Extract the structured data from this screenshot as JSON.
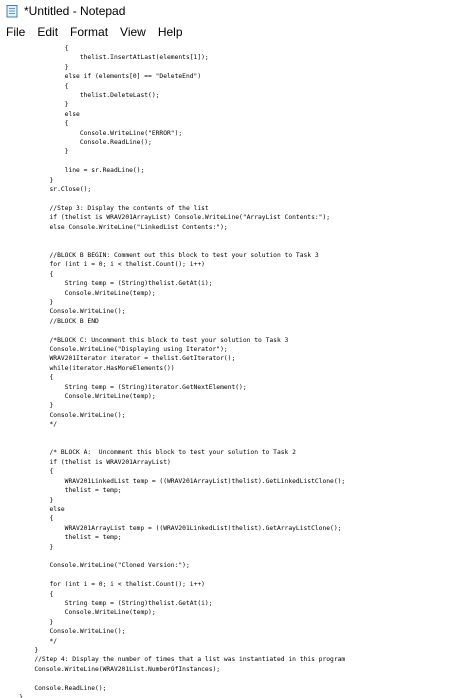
{
  "window": {
    "title": "*Untitled - Notepad"
  },
  "menu": [
    "File",
    "Edit",
    "Format",
    "View",
    "Help"
  ],
  "editor": {
    "lines": [
      "                {",
      "                    thelist.InsertAtLast(elements[1]);",
      "                }",
      "                else if (elements[0] == \"DeleteEnd\")",
      "                {",
      "                    thelist.DeleteLast();",
      "                }",
      "                else",
      "                {",
      "                    Console.WriteLine(\"ERROR\");",
      "                    Console.ReadLine();",
      "                }",
      "",
      "                line = sr.ReadLine();",
      "            }",
      "            sr.Close();",
      "",
      "            //Step 3: Display the contents of the list",
      "            if (thelist is WRAV201ArrayList) Console.WriteLine(\"ArrayList Contents:\");",
      "            else Console.WriteLine(\"LinkedList Contents:\");",
      "",
      "",
      "            //BLOCK B BEGIN: Comment out this block to test your solution to Task 3",
      "            for (int i = 0; i < thelist.Count(); i++)",
      "            {",
      "                String temp = (String)thelist.GetAt(i);",
      "                Console.WriteLine(temp);",
      "            }",
      "            Console.WriteLine();",
      "            //BLOCK B END",
      "",
      "            /*BLOCK C: Uncomment this block to test your solution to Task 3",
      "            Console.WriteLine(\"Displaying using Iterator\");",
      "            WRAV201Iterator iterator = thelist.GetIterator();",
      "            while(iterator.HasMoreElements())",
      "            {",
      "                String temp = (String)iterator.GetNextElement();",
      "                Console.WriteLine(temp);",
      "            }",
      "            Console.WriteLine();",
      "            */",
      "",
      "",
      "            /* BLOCK A:  Uncomment this block to test your solution to Task 2",
      "            if (thelist is WRAV201ArrayList)",
      "            {",
      "                WRAV201LinkedList temp = ((WRAV201ArrayList)thelist).GetLinkedListClone();",
      "                thelist = temp;",
      "            }",
      "            else",
      "            {",
      "                WRAV201ArrayList temp = ((WRAV201LinkedList)thelist).GetArrayListClone();",
      "                thelist = temp;",
      "            }",
      "",
      "            Console.WriteLine(\"Cloned Version:\");",
      "",
      "            for (int i = 0; i < thelist.Count(); i++)",
      "            {",
      "                String temp = (String)thelist.GetAt(i);",
      "                Console.WriteLine(temp);",
      "            }",
      "            Console.WriteLine();",
      "            */",
      "        }",
      "        //Step 4: Display the number of times that a list was instantiated in this program",
      "        Console.WriteLine(WRAV201List.NumberOfInstances);",
      "",
      "        Console.ReadLine();",
      "    }",
      "}",
      "}"
    ]
  }
}
